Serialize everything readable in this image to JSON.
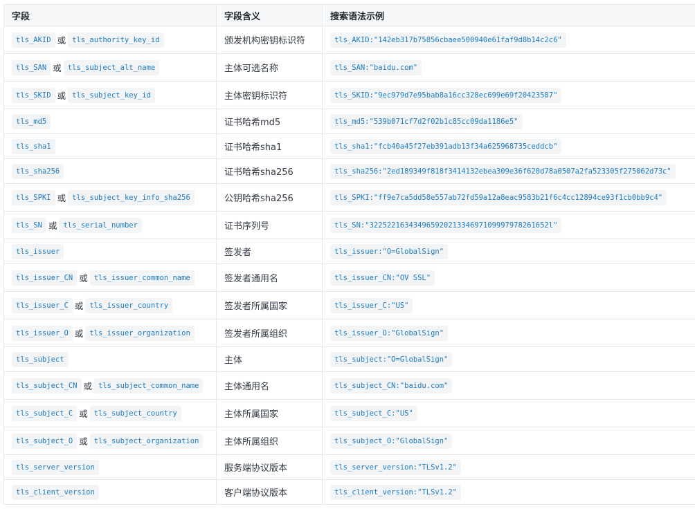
{
  "headers": [
    "字段",
    "字段含义",
    "搜索语法示例"
  ],
  "or_word": "或",
  "rows": [
    {
      "fields": [
        "tls_AKID",
        "tls_authority_key_id"
      ],
      "meaning": "颁发机构密钥标识符",
      "example": "tls_AKID:\"142eb317b75856cbaee500940e61faf9d8b14c2c6\""
    },
    {
      "fields": [
        "tls_SAN",
        "tls_subject_alt_name"
      ],
      "meaning": "主体可选名称",
      "example": "tls_SAN:\"baidu.com\""
    },
    {
      "fields": [
        "tls_SKID",
        "tls_subject_key_id"
      ],
      "meaning": "主体密钥标识符",
      "example": "tls_SKID:\"9ec979d7e95bab8a16cc328ec699e69f20423587\""
    },
    {
      "fields": [
        "tls_md5"
      ],
      "meaning": "证书哈希md5",
      "example": "tls_md5:\"539b071cf7d2f02b1c85cc09da1186e5\""
    },
    {
      "fields": [
        "tls_sha1"
      ],
      "meaning": "证书哈希sha1",
      "example": "tls_sha1:\"fcb40a45f27eb391adb13f34a625968735ceddcb\""
    },
    {
      "fields": [
        "tls_sha256"
      ],
      "meaning": "证书哈希sha256",
      "example": "tls_sha256:\"2ed189349f818f3414132ebea309e36f620d78a0507a2fa523305f275062d73c\""
    },
    {
      "fields": [
        "tls_SPKI",
        "tls_subject_key_info_sha256"
      ],
      "meaning": "公钥哈希sha256",
      "example": "tls_SPKI:\"ff9e7ca5dd58e557ab72fd59a12a8eac9583b21f6c4cc12894ce93f1cb0bb9c4\""
    },
    {
      "fields": [
        "tls_SN",
        "tls_serial_number"
      ],
      "meaning": "证书序列号",
      "example": "tls_SN:\"32252216343496592021334697109997978261652l\""
    },
    {
      "fields": [
        "tls_issuer"
      ],
      "meaning": "签发者",
      "example": "tls_issuer:\"O=GlobalSign\""
    },
    {
      "fields": [
        "tls_issuer_CN",
        "tls_issuer_common_name"
      ],
      "meaning": "签发者通用名",
      "example": "tls_issuer_CN:\"OV SSL\""
    },
    {
      "fields": [
        "tls_issuer_C",
        "tls_issuer_country"
      ],
      "meaning": "签发者所属国家",
      "example": "tls_issuer_C:\"US\""
    },
    {
      "fields": [
        "tls_issuer_O",
        "tls_issuer_organization"
      ],
      "meaning": "签发者所属组织",
      "example": "tls_issuer_O:\"GlobalSign\""
    },
    {
      "fields": [
        "tls_subject"
      ],
      "meaning": "主体",
      "example": "tls_subject:\"O=GlobalSign\""
    },
    {
      "fields": [
        "tls_subject_CN",
        "tls_subject_common_name"
      ],
      "meaning": "主体通用名",
      "example": "tls_subject_CN:\"baidu.com\""
    },
    {
      "fields": [
        "tls_subject_C",
        "tls_subject_country"
      ],
      "meaning": "主体所属国家",
      "example": "tls_subject_C:\"US\""
    },
    {
      "fields": [
        "tls_subject_O",
        "tls_subject_organization"
      ],
      "meaning": "主体所属组织",
      "example": "tls_subject_O:\"GlobalSign\""
    },
    {
      "fields": [
        "tls_server_version"
      ],
      "meaning": "服务端协议版本",
      "example": "tls_server_version:\"TLSv1.2\""
    },
    {
      "fields": [
        "tls_client_version"
      ],
      "meaning": "客户端协议版本",
      "example": "tls_client_version:\"TLSv1.2\""
    }
  ]
}
